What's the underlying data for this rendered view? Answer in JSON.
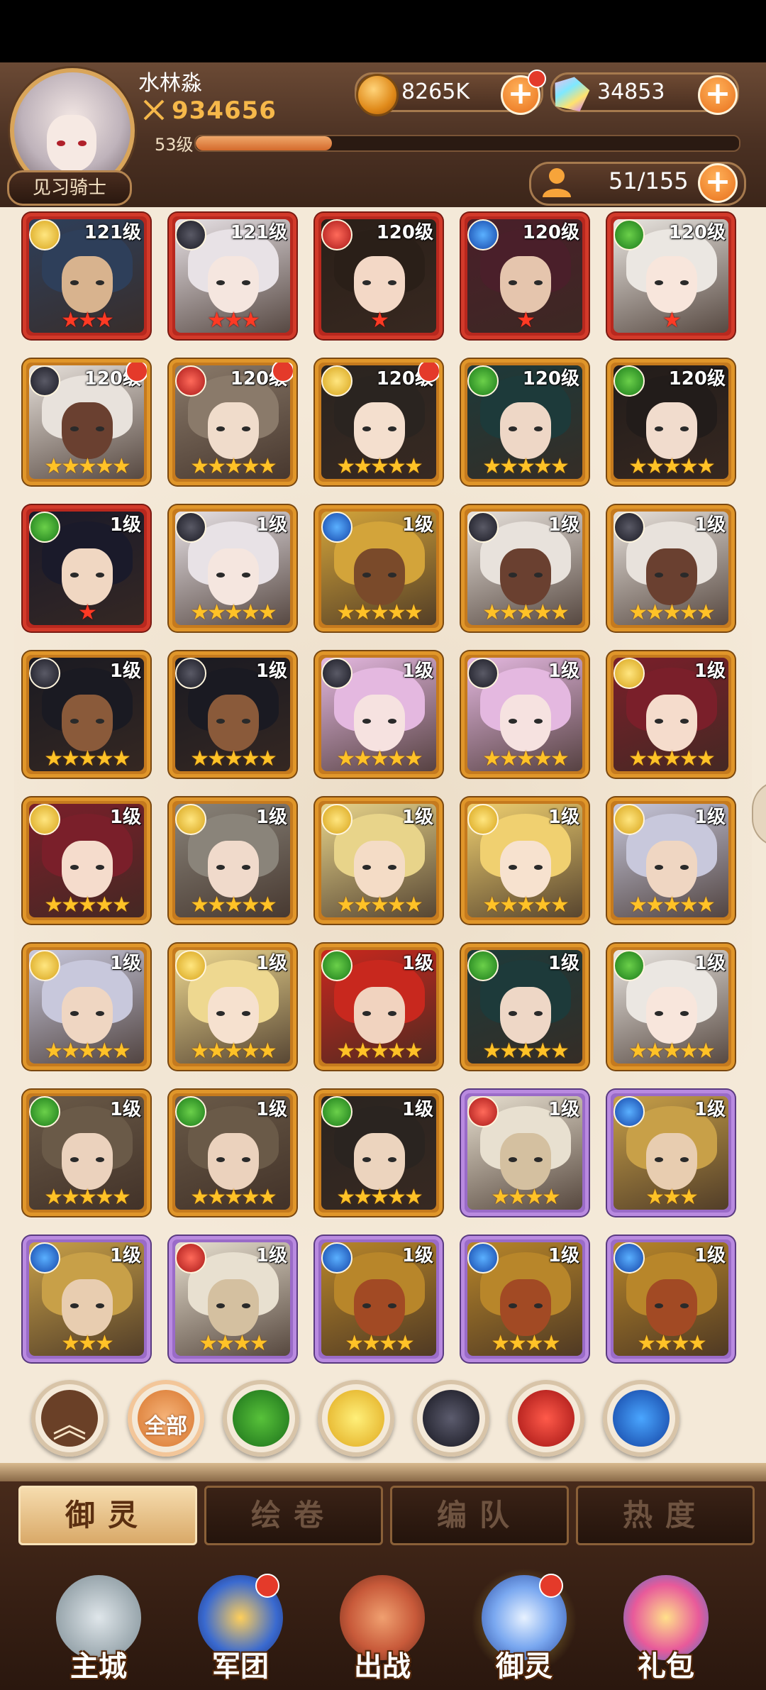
{
  "player": {
    "name": "水林淼",
    "power": "934656",
    "level_label": "53级",
    "level_progress": 0.25,
    "title": "见习骑士"
  },
  "currency": {
    "gold": "8265K",
    "gems": "34853"
  },
  "capacity": "51/155",
  "heroes": [
    {
      "element": "holy",
      "level": "121级",
      "rarity": "red",
      "stars": 3,
      "star_color": "red",
      "hair": "#2e3f5a",
      "skin": "#d8b38e",
      "dot": false
    },
    {
      "element": "dark",
      "level": "121级",
      "rarity": "red",
      "stars": 3,
      "star_color": "red",
      "hair": "#e8e2e6",
      "skin": "#f5e6df",
      "dot": false
    },
    {
      "element": "fire",
      "level": "120级",
      "rarity": "red",
      "stars": 1,
      "star_color": "red",
      "hair": "#2a1f18",
      "skin": "#f3d8c6",
      "dot": false
    },
    {
      "element": "water",
      "level": "120级",
      "rarity": "red",
      "stars": 1,
      "star_color": "red",
      "hair": "#4a1f2a",
      "skin": "#e5c5ad",
      "dot": false
    },
    {
      "element": "nature",
      "level": "120级",
      "rarity": "red",
      "stars": 1,
      "star_color": "red",
      "hair": "#ebe7e2",
      "skin": "#f8e6dc",
      "dot": false
    },
    {
      "element": "dark",
      "level": "120级",
      "rarity": "gold",
      "stars": 5,
      "star_color": "gold",
      "hair": "#e8e2dc",
      "skin": "#6a4030",
      "dot": true
    },
    {
      "element": "fire",
      "level": "120级",
      "rarity": "gold",
      "stars": 5,
      "star_color": "gold",
      "hair": "#8a7a6a",
      "skin": "#f0dccb",
      "dot": true
    },
    {
      "element": "holy",
      "level": "120级",
      "rarity": "gold",
      "stars": 5,
      "star_color": "gold",
      "hair": "#2a2420",
      "skin": "#f4dfce",
      "dot": true
    },
    {
      "element": "nature",
      "level": "120级",
      "rarity": "gold",
      "stars": 5,
      "star_color": "gold",
      "hair": "#1d3a3a",
      "skin": "#eed7c6",
      "dot": false
    },
    {
      "element": "nature",
      "level": "120级",
      "rarity": "gold",
      "stars": 5,
      "star_color": "gold",
      "hair": "#221c1a",
      "skin": "#f1dccd",
      "dot": false
    },
    {
      "element": "nature",
      "level": "1级",
      "rarity": "red",
      "stars": 1,
      "star_color": "red",
      "hair": "#1a1a2a",
      "skin": "#f0d7c2",
      "dot": false
    },
    {
      "element": "dark",
      "level": "1级",
      "rarity": "gold",
      "stars": 5,
      "star_color": "gold",
      "hair": "#e8e2e6",
      "skin": "#f5e6df",
      "dot": false
    },
    {
      "element": "water",
      "level": "1级",
      "rarity": "gold",
      "stars": 5,
      "star_color": "gold",
      "hair": "#d3a43a",
      "skin": "#7a4a2a",
      "dot": false
    },
    {
      "element": "dark",
      "level": "1级",
      "rarity": "gold",
      "stars": 5,
      "star_color": "gold",
      "hair": "#e8e2dc",
      "skin": "#6a4030",
      "dot": false
    },
    {
      "element": "dark",
      "level": "1级",
      "rarity": "gold",
      "stars": 5,
      "star_color": "gold",
      "hair": "#e8e2dc",
      "skin": "#6a4030",
      "dot": false
    },
    {
      "element": "dark",
      "level": "1级",
      "rarity": "gold",
      "stars": 5,
      "star_color": "gold",
      "hair": "#1a1a22",
      "skin": "#8a5a3a",
      "dot": false
    },
    {
      "element": "dark",
      "level": "1级",
      "rarity": "gold",
      "stars": 5,
      "star_color": "gold",
      "hair": "#1a1a22",
      "skin": "#8a5a3a",
      "dot": false
    },
    {
      "element": "dark",
      "level": "1级",
      "rarity": "gold",
      "stars": 5,
      "star_color": "gold",
      "hair": "#e4b8e0",
      "skin": "#f6e2e0",
      "dot": false
    },
    {
      "element": "dark",
      "level": "1级",
      "rarity": "gold",
      "stars": 5,
      "star_color": "gold",
      "hair": "#e4b8e0",
      "skin": "#f6e2e0",
      "dot": false
    },
    {
      "element": "holy",
      "level": "1级",
      "rarity": "gold",
      "stars": 5,
      "star_color": "gold",
      "hair": "#7a1f2a",
      "skin": "#f5dccc",
      "dot": false
    },
    {
      "element": "holy",
      "level": "1级",
      "rarity": "gold",
      "stars": 5,
      "star_color": "gold",
      "hair": "#7a1f2a",
      "skin": "#f5dccc",
      "dot": false
    },
    {
      "element": "holy",
      "level": "1级",
      "rarity": "gold",
      "stars": 5,
      "star_color": "gold",
      "hair": "#8a847a",
      "skin": "#f0dacb",
      "dot": false
    },
    {
      "element": "holy",
      "level": "1级",
      "rarity": "gold",
      "stars": 5,
      "star_color": "gold",
      "hair": "#e8d48a",
      "skin": "#f4dcc6",
      "dot": false
    },
    {
      "element": "holy",
      "level": "1级",
      "rarity": "gold",
      "stars": 5,
      "star_color": "gold",
      "hair": "#f0d070",
      "skin": "#f7e2cf",
      "dot": false
    },
    {
      "element": "holy",
      "level": "1级",
      "rarity": "gold",
      "stars": 5,
      "star_color": "gold",
      "hair": "#c8c8dc",
      "skin": "#efd6c2",
      "dot": false
    },
    {
      "element": "holy",
      "level": "1级",
      "rarity": "gold",
      "stars": 5,
      "star_color": "gold",
      "hair": "#c8c8dc",
      "skin": "#efd6c2",
      "dot": false
    },
    {
      "element": "holy",
      "level": "1级",
      "rarity": "gold",
      "stars": 5,
      "star_color": "gold",
      "hair": "#eed890",
      "skin": "#f6e1cf",
      "dot": false
    },
    {
      "element": "nature",
      "level": "1级",
      "rarity": "gold",
      "stars": 5,
      "star_color": "gold",
      "hair": "#c8281e",
      "skin": "#f1d3bf",
      "dot": false
    },
    {
      "element": "nature",
      "level": "1级",
      "rarity": "gold",
      "stars": 5,
      "star_color": "gold",
      "hair": "#1d3a3a",
      "skin": "#eed7c6",
      "dot": false
    },
    {
      "element": "nature",
      "level": "1级",
      "rarity": "gold",
      "stars": 5,
      "star_color": "gold",
      "hair": "#ebe7e2",
      "skin": "#f8e6dc",
      "dot": false
    },
    {
      "element": "nature",
      "level": "1级",
      "rarity": "gold",
      "stars": 5,
      "star_color": "gold",
      "hair": "#6a5a48",
      "skin": "#ebd2bd",
      "dot": false
    },
    {
      "element": "nature",
      "level": "1级",
      "rarity": "gold",
      "stars": 5,
      "star_color": "gold",
      "hair": "#6a5a48",
      "skin": "#ebd2bd",
      "dot": false
    },
    {
      "element": "nature",
      "level": "1级",
      "rarity": "gold",
      "stars": 5,
      "star_color": "gold",
      "hair": "#2a2420",
      "skin": "#ecd4be",
      "dot": false
    },
    {
      "element": "fire",
      "level": "1级",
      "rarity": "purple",
      "stars": 4,
      "star_color": "gold",
      "hair": "#e8e0d0",
      "skin": "#d4c0a0",
      "dot": false
    },
    {
      "element": "water",
      "level": "1级",
      "rarity": "purple",
      "stars": 3,
      "star_color": "gold",
      "hair": "#c8a048",
      "skin": "#e8cdb0",
      "dot": false
    },
    {
      "element": "water",
      "level": "1级",
      "rarity": "purple",
      "stars": 3,
      "star_color": "gold",
      "hair": "#c8a048",
      "skin": "#e8cdb0",
      "dot": false
    },
    {
      "element": "fire",
      "level": "1级",
      "rarity": "purple",
      "stars": 4,
      "star_color": "gold",
      "hair": "#e8e0d0",
      "skin": "#d4c0a0",
      "dot": false
    },
    {
      "element": "water",
      "level": "1级",
      "rarity": "purple",
      "stars": 4,
      "star_color": "gold",
      "hair": "#b8862a",
      "skin": "#a24a24",
      "dot": false
    },
    {
      "element": "water",
      "level": "1级",
      "rarity": "purple",
      "stars": 4,
      "star_color": "gold",
      "hair": "#b8862a",
      "skin": "#a24a24",
      "dot": false
    },
    {
      "element": "water",
      "level": "1级",
      "rarity": "purple",
      "stars": 4,
      "star_color": "gold",
      "hair": "#b8862a",
      "skin": "#a24a24",
      "dot": false
    }
  ],
  "filters": {
    "all_label": "全部",
    "icons": [
      "collapse-icon",
      "nature-element-icon",
      "holy-element-icon",
      "dark-element-icon",
      "fire-element-icon",
      "water-element-icon"
    ]
  },
  "tabs": [
    {
      "label": "御灵",
      "active": true
    },
    {
      "label": "绘卷",
      "active": false
    },
    {
      "label": "编队",
      "active": false
    },
    {
      "label": "热度",
      "active": false
    }
  ],
  "nav": [
    {
      "label": "主城",
      "dot": false,
      "color": "#b8c4c8"
    },
    {
      "label": "军团",
      "dot": true,
      "color": "#3a6ad0"
    },
    {
      "label": "出战",
      "dot": false,
      "color": "#c85a3a"
    },
    {
      "label": "御灵",
      "dot": true,
      "active": true,
      "color": "#7aa8f0"
    },
    {
      "label": "礼包",
      "dot": false,
      "color": "#e85a9a"
    }
  ],
  "colors": {
    "accent": "#e8701c",
    "panel": "#f4e9d8",
    "header": "#4a3022"
  }
}
